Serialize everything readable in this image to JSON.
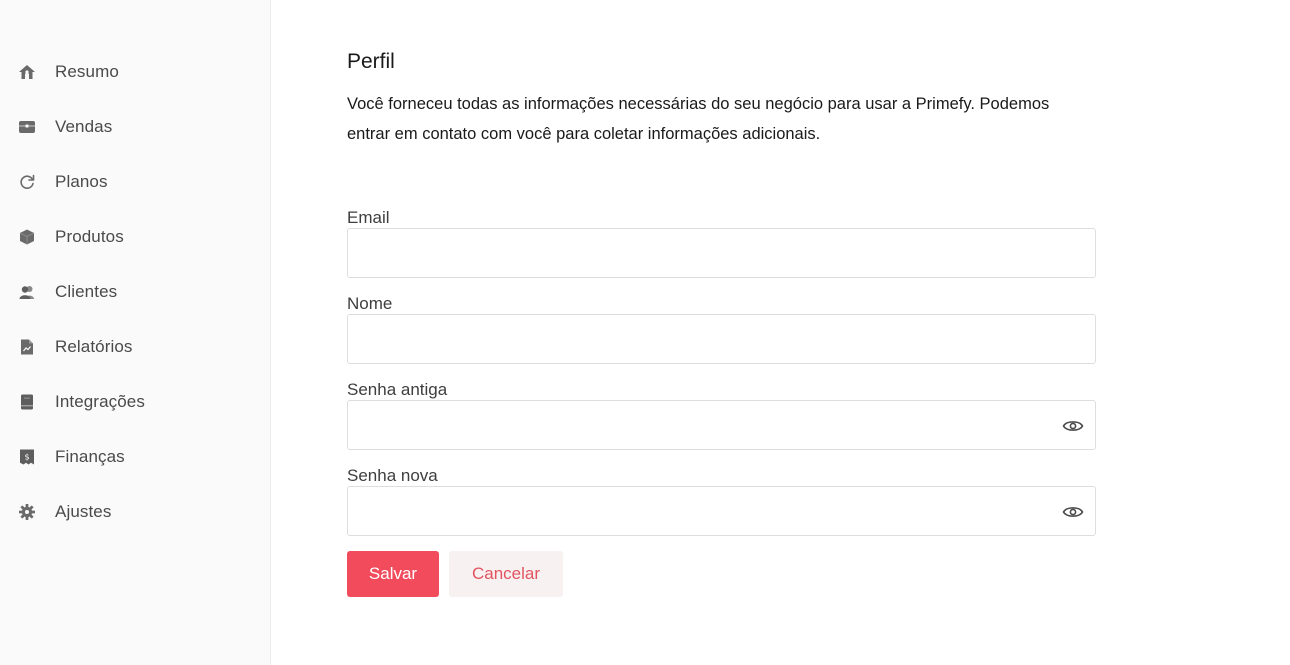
{
  "sidebar": {
    "items": [
      {
        "label": "Resumo",
        "icon": "home-icon"
      },
      {
        "label": "Vendas",
        "icon": "wallet-icon"
      },
      {
        "label": "Planos",
        "icon": "refresh-icon"
      },
      {
        "label": "Produtos",
        "icon": "box-icon"
      },
      {
        "label": "Clientes",
        "icon": "users-icon"
      },
      {
        "label": "Relatórios",
        "icon": "report-icon"
      },
      {
        "label": "Integrações",
        "icon": "book-icon"
      },
      {
        "label": "Finanças",
        "icon": "finance-icon"
      },
      {
        "label": "Ajustes",
        "icon": "gear-icon"
      }
    ]
  },
  "main": {
    "title": "Perfil",
    "description": "Você forneceu todas as informações necessárias do seu negócio para usar a Primefy. Podemos entrar em contato com você para coletar informações adicionais.",
    "fields": {
      "email": {
        "label": "Email",
        "value": ""
      },
      "name": {
        "label": "Nome",
        "value": ""
      },
      "old_password": {
        "label": "Senha antiga",
        "value": ""
      },
      "new_password": {
        "label": "Senha nova",
        "value": ""
      }
    },
    "actions": {
      "save_label": "Salvar",
      "cancel_label": "Cancelar"
    }
  },
  "colors": {
    "accent": "#f24b5c",
    "sidebar_bg": "#fafafa",
    "icon": "#5a5a5a"
  }
}
